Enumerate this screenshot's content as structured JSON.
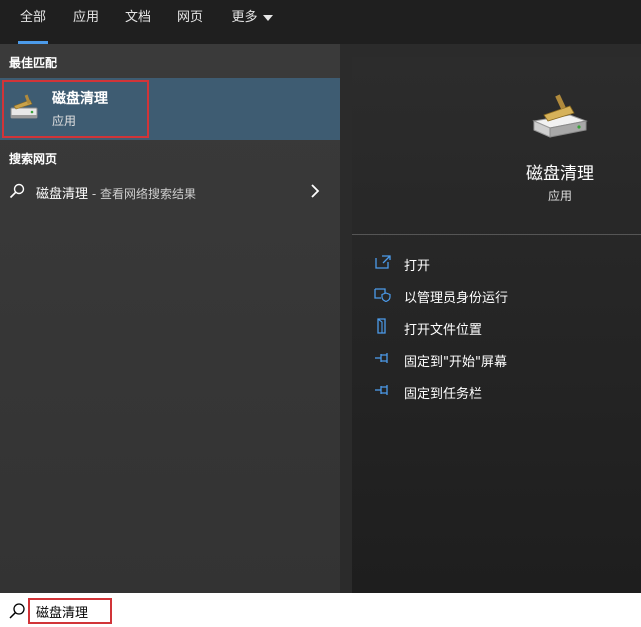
{
  "tabs": [
    {
      "label": "全部",
      "active": true
    },
    {
      "label": "应用",
      "active": false
    },
    {
      "label": "文档",
      "active": false
    },
    {
      "label": "网页",
      "active": false
    },
    {
      "label": "更多",
      "active": false
    }
  ],
  "best_match": {
    "section_label": "最佳匹配",
    "title": "磁盘清理",
    "subtitle": "应用",
    "icon": "disk-cleanup-icon"
  },
  "web": {
    "section_label": "搜索网页",
    "query": "磁盘清理",
    "suffix": " - 查看网络搜索结果"
  },
  "detail": {
    "title": "磁盘清理",
    "subtitle": "应用",
    "actions": [
      {
        "label": "打开",
        "icon": "open-icon"
      },
      {
        "label": "以管理员身份运行",
        "icon": "shield-icon"
      },
      {
        "label": "打开文件位置",
        "icon": "folder-icon"
      },
      {
        "label": "固定到\"开始\"屏幕",
        "icon": "pin-icon"
      },
      {
        "label": "固定到任务栏",
        "icon": "pin-icon"
      }
    ]
  },
  "search": {
    "value": "磁盘清理"
  },
  "colors": {
    "accent": "#4c9bea",
    "selection": "#3e5c72",
    "highlight_outline": "#d13438"
  }
}
